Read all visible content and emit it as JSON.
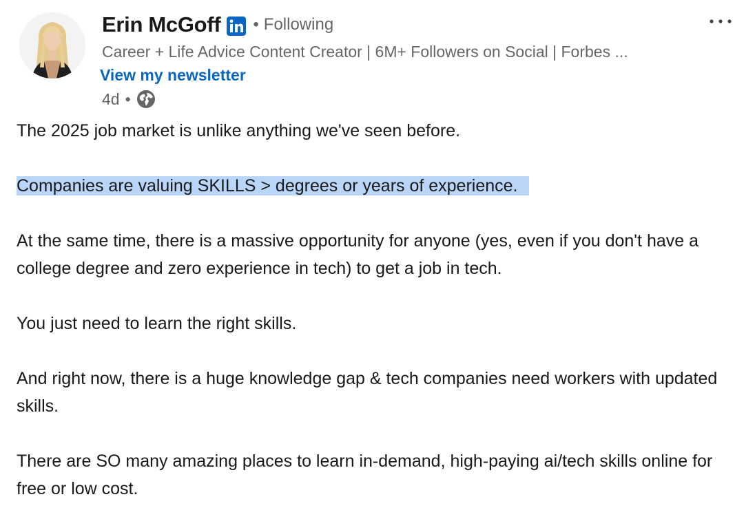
{
  "author": {
    "name": "Erin McGoff",
    "follow_status": "Following",
    "headline": "Career + Life Advice Content Creator | 6M+ Followers on Social | Forbes ...",
    "newsletter_link": "View my newsletter",
    "post_age": "4d",
    "visibility_icon": "globe-icon",
    "badge_icon": "linkedin-icon"
  },
  "post": {
    "paragraphs": [
      "The 2025 job market is unlike anything we've seen before.",
      "Companies are valuing SKILLS > degrees or years of experience.",
      "At the same time, there is a massive opportunity for anyone (yes, even if you don't have a college degree and zero experience in tech) to get a job in tech.",
      "You just need to learn the right skills.",
      "And right now, there is a huge knowledge gap & tech companies need workers with updated skills.",
      "There are SO many amazing places to learn in-demand, high-paying ai/tech skills online for free or low cost."
    ]
  },
  "colors": {
    "brand_blue": "#0a66c2",
    "selection_highlight": "#b9d6f8",
    "muted_text": "#666666",
    "primary_text": "#191919"
  },
  "controls": {
    "more_icon": "more-options-icon"
  }
}
